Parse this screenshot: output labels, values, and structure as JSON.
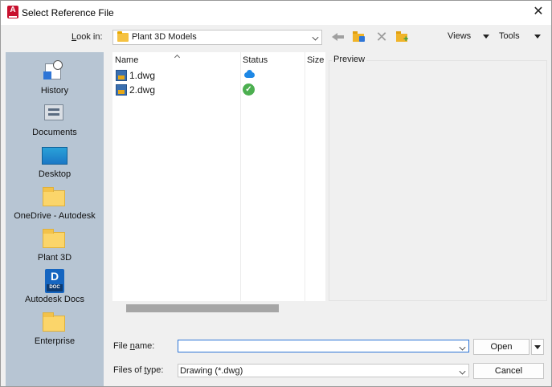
{
  "window": {
    "title": "Select Reference File",
    "app_icon": "autocad-plant3d-icon",
    "close_glyph": "✕"
  },
  "lookin": {
    "label": "Look in:",
    "value": "Plant 3D Models"
  },
  "toolbar": {
    "views_label": "Views",
    "tools_label": "Tools",
    "delete_glyph": "✕",
    "icons": [
      "back-icon",
      "up-folder-icon",
      "delete-icon",
      "new-folder-icon"
    ]
  },
  "places": [
    {
      "label": "History",
      "icon": "history-icon"
    },
    {
      "label": "Documents",
      "icon": "documents-icon"
    },
    {
      "label": "Desktop",
      "icon": "desktop-icon"
    },
    {
      "label": "OneDrive - Autodesk",
      "icon": "folder-icon"
    },
    {
      "label": "Plant 3D",
      "icon": "folder-icon"
    },
    {
      "label": "Autodesk Docs",
      "icon": "autodesk-docs-icon",
      "badge_letter": "D",
      "badge_sub": "DOC"
    },
    {
      "label": "Enterprise",
      "icon": "folder-icon"
    }
  ],
  "filelist": {
    "columns": [
      "Name",
      "Status",
      "Size"
    ],
    "files": [
      {
        "name": "1.dwg",
        "status_icon": "cloud-icon"
      },
      {
        "name": "2.dwg",
        "status_icon": "check-circle-icon",
        "status_glyph": "✓"
      }
    ]
  },
  "preview": {
    "label": "Preview"
  },
  "bottom": {
    "filename_label": "File name:",
    "filename_value": "",
    "filetype_label": "Files of type:",
    "filetype_value": "Drawing (*.dwg)",
    "open_label": "Open",
    "cancel_label": "Cancel"
  },
  "colors": {
    "places_bg": "#b7c5d3",
    "accent_blue": "#2e75d6",
    "app_red": "#c8102e"
  }
}
